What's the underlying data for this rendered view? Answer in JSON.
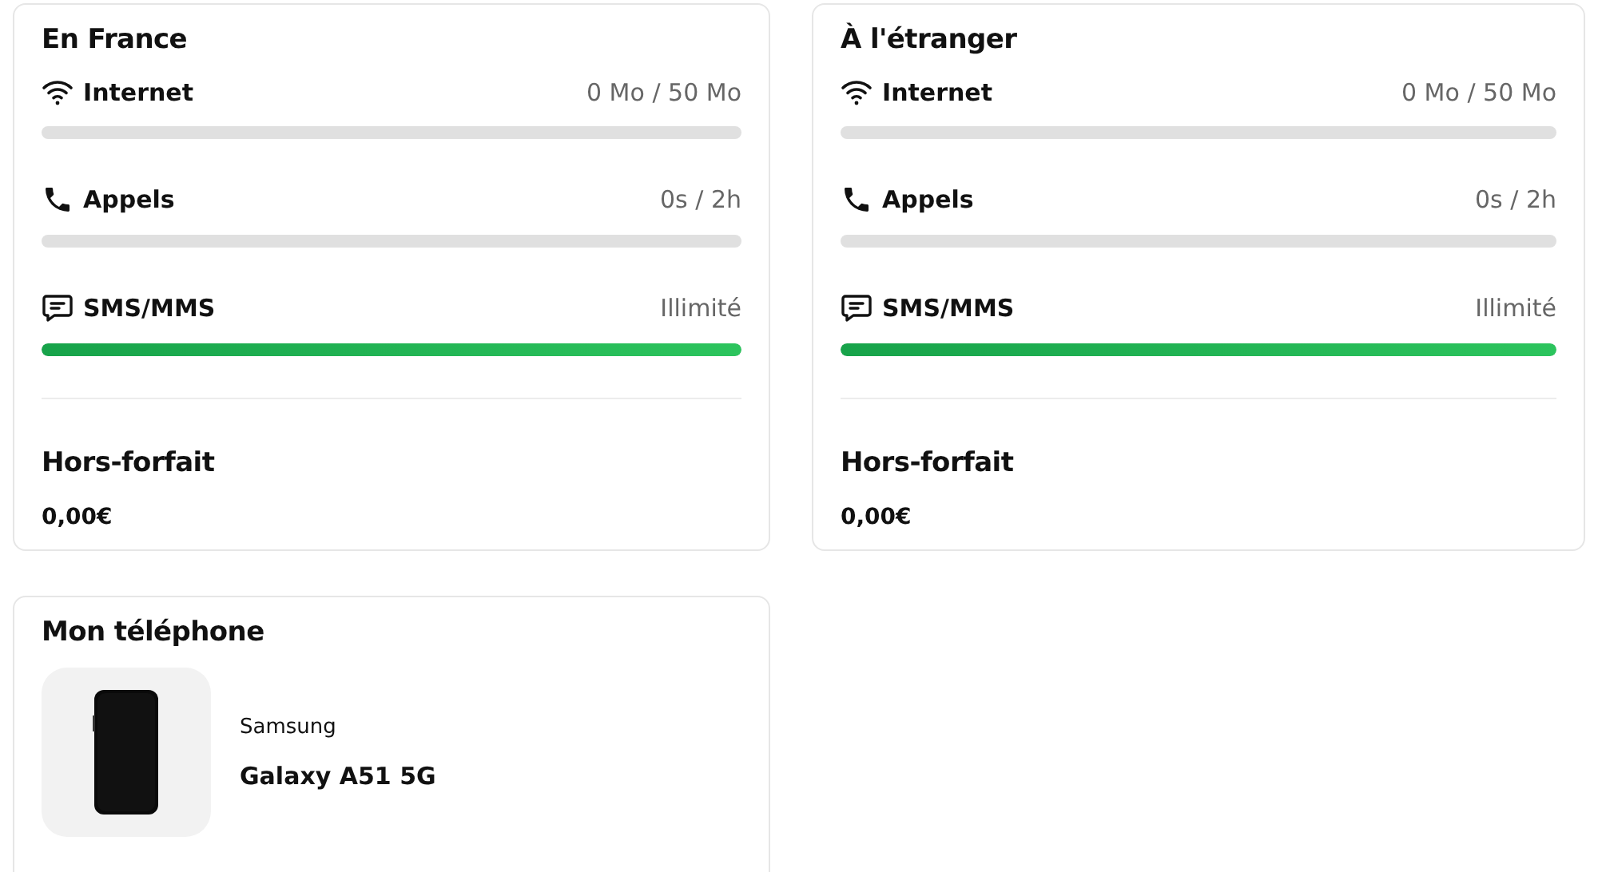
{
  "plans": [
    {
      "title": "En France",
      "meters": [
        {
          "kind": "internet",
          "label": "Internet",
          "reading": "0 Mo / 50 Mo",
          "level": 0
        },
        {
          "kind": "calls",
          "label": "Appels",
          "reading": "0s / 2h",
          "level": 0
        },
        {
          "kind": "sms",
          "label": "SMS/MMS",
          "reading": "Illimité",
          "level": 1
        }
      ],
      "extra": {
        "label": "Hors-forfait",
        "amount": "0,00€"
      }
    },
    {
      "title": "À l'étranger",
      "meters": [
        {
          "kind": "internet",
          "label": "Internet",
          "reading": "0 Mo / 50 Mo",
          "level": 0
        },
        {
          "kind": "calls",
          "label": "Appels",
          "reading": "0s / 2h",
          "level": 0
        },
        {
          "kind": "sms",
          "label": "SMS/MMS",
          "reading": "Illimité",
          "level": 1
        }
      ],
      "extra": {
        "label": "Hors-forfait",
        "amount": "0,00€"
      }
    }
  ],
  "phone": {
    "title": "Mon téléphone",
    "brand": "Samsung",
    "model": "Galaxy A51 5G"
  }
}
